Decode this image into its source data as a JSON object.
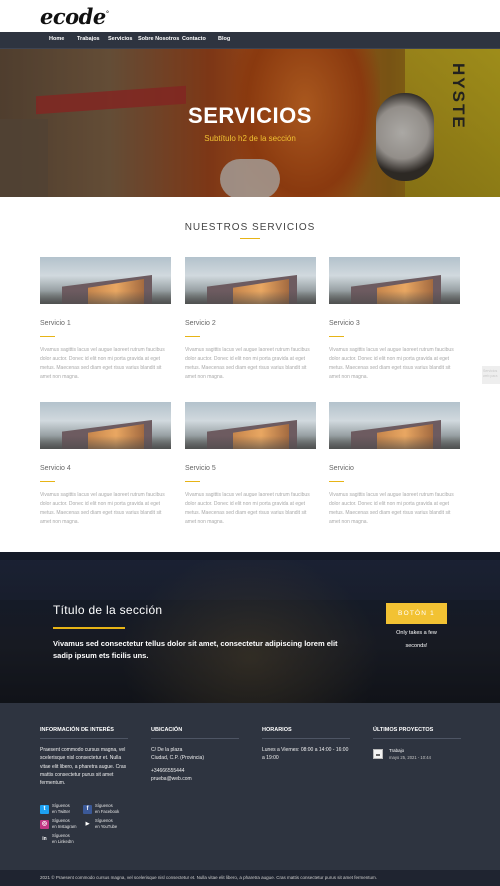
{
  "brand": {
    "logo": "ecode",
    "logo_mark": "°"
  },
  "nav": {
    "items": [
      "Home",
      "Trabajos",
      "Servicios",
      "Sobre Nosotros",
      "Contacto",
      "Blog"
    ]
  },
  "hero": {
    "title": "SERVICIOS",
    "subtitle": "Subtítulo h2 de la sección",
    "hyster_text": "HYSTE"
  },
  "services": {
    "heading": "NUESTROS SERVICIOS",
    "items": [
      {
        "title": "Servicio 1",
        "desc": "Vivamus sagittis lacus vel augue laoreet rutrum faucibus dolor auctor. Donec id elit non mi porta gravida at eget metus. Maecenas sed diam eget risus varius blandit sit amet non magna."
      },
      {
        "title": "Servicio 2",
        "desc": "Vivamus sagittis lacus vel augue laoreet rutrum faucibus dolor auctor. Donec id elit non mi porta gravida at eget metus. Maecenas sed diam eget risus varius blandit sit amet non magna."
      },
      {
        "title": "Servicio 3",
        "desc": "Vivamus sagittis lacus vel augue laoreet rutrum faucibus dolor auctor. Donec id elit non mi porta gravida at eget metus. Maecenas sed diam eget risus varius blandit sit amet non magna."
      },
      {
        "title": "Servicio 4",
        "desc": "Vivamus sagittis lacus vel augue laoreet rutrum faucibus dolor auctor. Donec id elit non mi porta gravida at eget metus. Maecenas sed diam eget risus varius blandit sit amet non magna."
      },
      {
        "title": "Servicio 5",
        "desc": "Vivamus sagittis lacus vel augue laoreet rutrum faucibus dolor auctor. Donec id elit non mi porta gravida at eget metus. Maecenas sed diam eget risus varius blandit sit amet non magna."
      },
      {
        "title": "Servicio",
        "desc": "Vivamus sagittis lacus vel augue laoreet rutrum faucibus dolor auctor. Donec id elit non mi porta gravida at eget metus. Maecenas sed diam eget risus varius blandit sit amet non magna."
      }
    ]
  },
  "side_pill": "Servicios web para",
  "cta": {
    "title": "Título de la sección",
    "body": "Vivamus sed consectetur tellus dolor sit amet, consectetur adipiscing lorem elit sadip ipsum ets ficilis uns.",
    "button": "BOTÓN 1",
    "note_line1": "Only takes a few",
    "note_line2": "seconds!"
  },
  "footer": {
    "info": {
      "heading": "INFORMACIÓN DE INTERÉS",
      "text": "Praesent commodo cursus magna, vel scelerisque nisl consectetur et. Nulla vitae elit libero, a pharetra augue. Cras mattis consectetur purus sit amet fermentum."
    },
    "location": {
      "heading": "UBICACIÓN",
      "line1": "C/ De la plaza",
      "line2": "Ciudad, C.P. (Provincia)",
      "phone": "+34666555444",
      "email": "prueba@web.com"
    },
    "hours": {
      "heading": "HORARIOS",
      "text": "Lunes a Viernes: 08:00 a 14:00 - 16:00 a 19:00"
    },
    "projects": {
      "heading": "ÚLTIMOS PROYECTOS",
      "items": [
        {
          "title": "Trabajo",
          "date": "mayo 25, 2021 - 10:44"
        }
      ]
    },
    "social": [
      {
        "line1": "Síguenos",
        "line2": "en Twitter",
        "icon": "twitter-icon",
        "color": "#1da1f2",
        "glyph": "t"
      },
      {
        "line1": "Síguenos",
        "line2": "en Facebook",
        "icon": "facebook-icon",
        "color": "#3b5998",
        "glyph": "f"
      },
      {
        "line1": "Síguenos",
        "line2": "en Instagram",
        "icon": "instagram-icon",
        "color": "#c13584",
        "glyph": "◎"
      },
      {
        "line1": "Síguenos",
        "line2": "en YouTube",
        "icon": "youtube-icon",
        "color": "#2e3440",
        "glyph": "▶"
      },
      {
        "line1": "Síguenos",
        "line2": "en LinkedIn",
        "icon": "linkedin-icon",
        "color": "#2e3440",
        "glyph": "in"
      }
    ],
    "copyright": "2021 © Praesent commodo cursus magna, vel scelerisque nisl consectetur et. Nulla vitae elit libero, a pharetra augue. Cras mattis consectetur purus sit amet fermentum."
  },
  "colors": {
    "accent": "#e7b416",
    "button": "#f2c233",
    "nav_bg": "#2e3440",
    "footer_bg": "#2e3440"
  }
}
